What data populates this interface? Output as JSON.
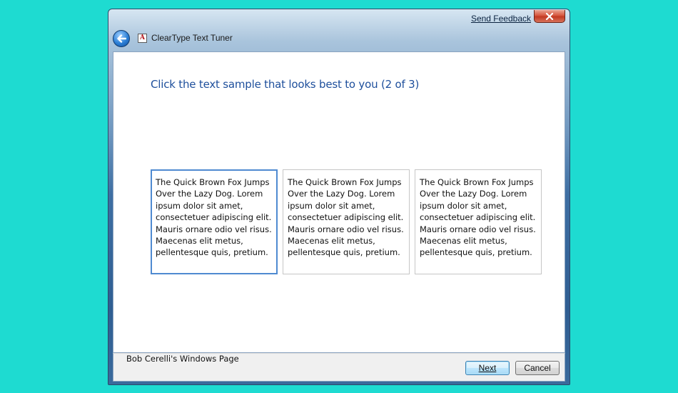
{
  "titlebar": {
    "send_feedback": "Send Feedback",
    "title": "ClearType Text Tuner",
    "app_icon_glyph": "A",
    "icons": {
      "back": "back-arrow-icon",
      "close": "close-icon",
      "app": "cleartype-icon"
    }
  },
  "main": {
    "heading": "Click the text sample that looks best to you (2 of 3)",
    "samples": [
      {
        "text": "The Quick Brown Fox Jumps Over the Lazy Dog. Lorem ipsum dolor sit amet, consectetuer adipiscing elit. Mauris ornare odio vel risus. Maecenas elit metus, pellentesque quis, pretium.",
        "selected": true
      },
      {
        "text": "The Quick Brown Fox Jumps Over the Lazy Dog. Lorem ipsum dolor sit amet, consectetuer adipiscing elit. Mauris ornare odio vel risus. Maecenas elit metus, pellentesque quis, pretium.",
        "selected": false
      },
      {
        "text": "The Quick Brown Fox Jumps Over the Lazy Dog. Lorem ipsum dolor sit amet, consectetuer adipiscing elit. Mauris ornare odio vel risus. Maecenas elit metus, pellentesque quis, pretium.",
        "selected": false
      }
    ]
  },
  "footer": {
    "credit": "Bob Cerelli's Windows Page",
    "next_label": "Next",
    "cancel_label": "Cancel"
  },
  "colors": {
    "desktop": "#1edbd1",
    "heading": "#1e4f9c",
    "selection_border": "#4f8ad1"
  }
}
